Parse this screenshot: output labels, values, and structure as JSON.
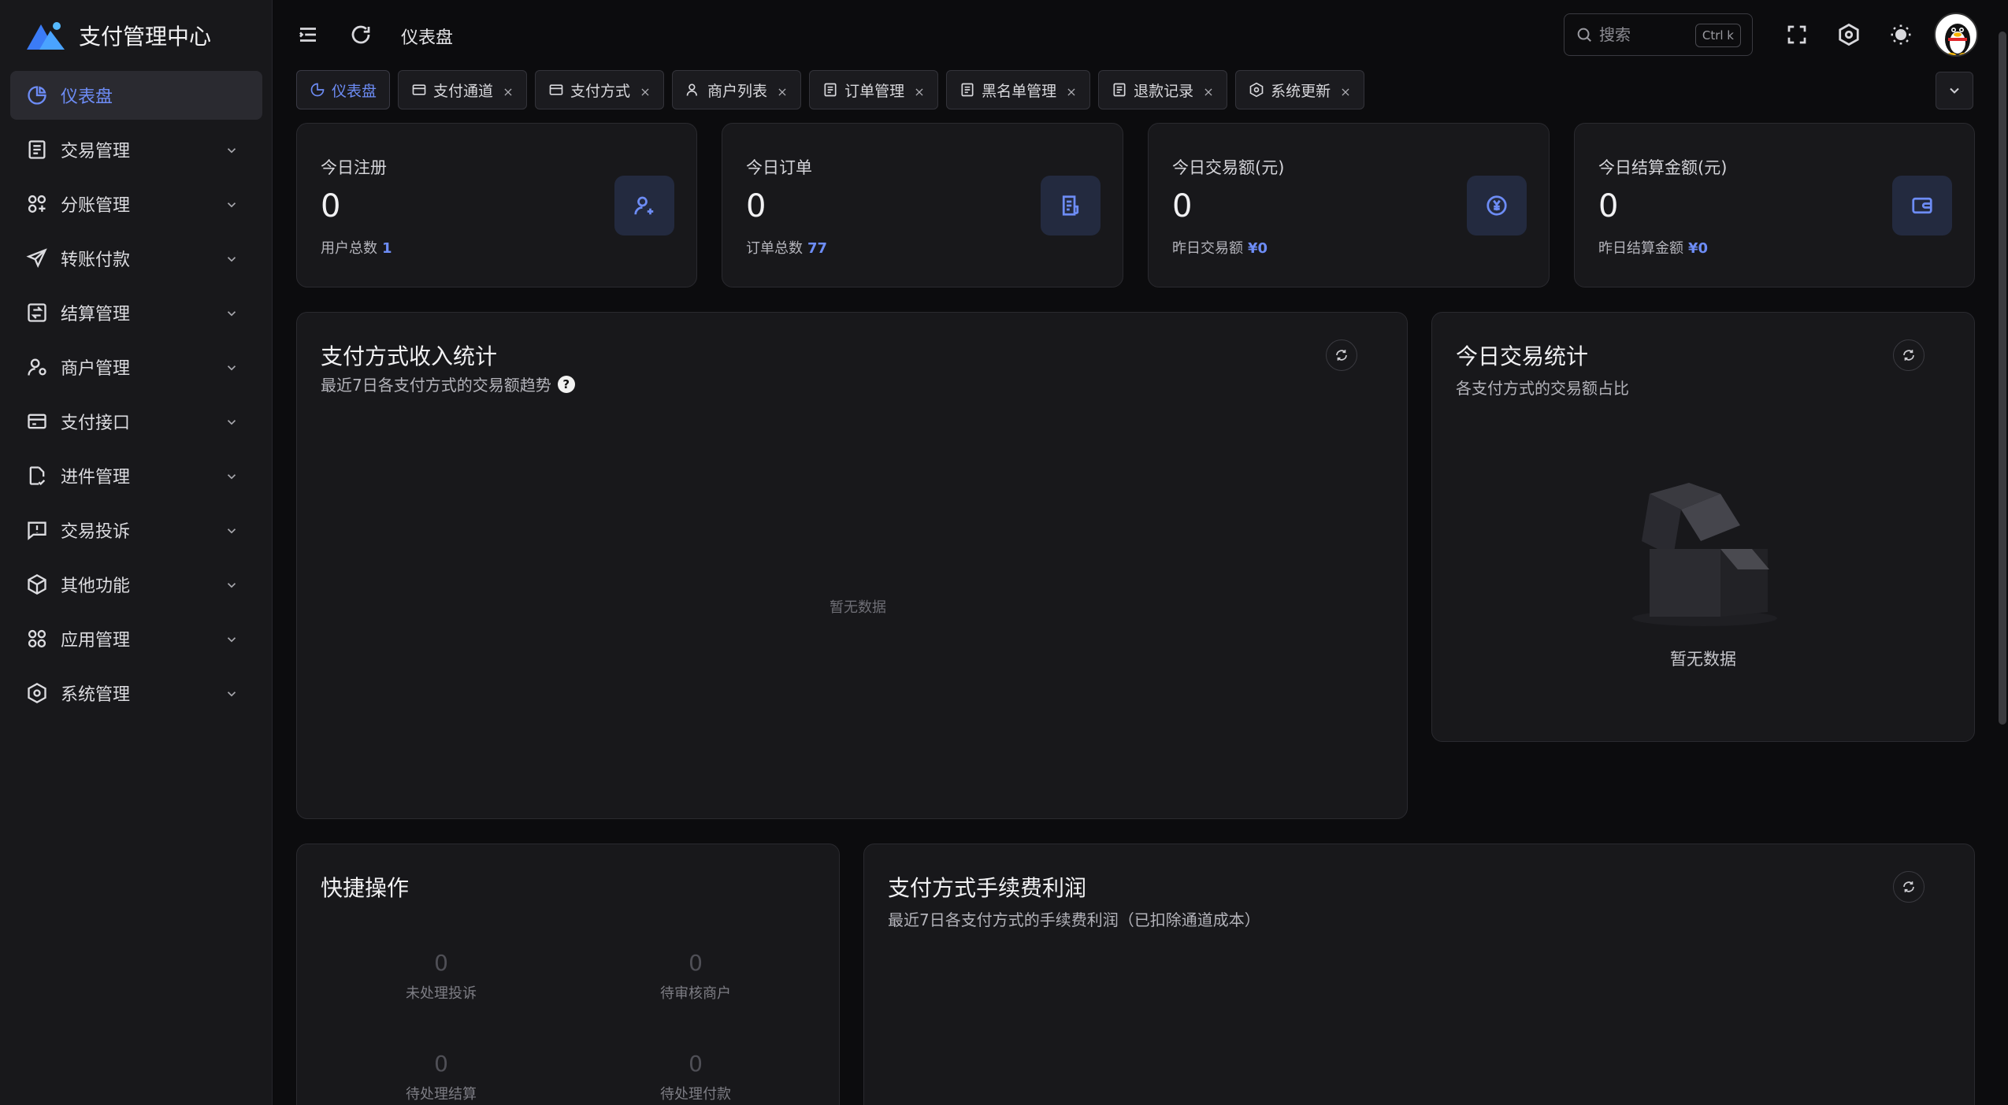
{
  "app": {
    "title": "支付管理中心"
  },
  "sidebar": {
    "items": [
      {
        "label": "仪表盘",
        "icon": "pie-chart-icon",
        "active": true
      },
      {
        "label": "交易管理",
        "icon": "receipt-icon"
      },
      {
        "label": "分账管理",
        "icon": "split-icon"
      },
      {
        "label": "转账付款",
        "icon": "send-icon"
      },
      {
        "label": "结算管理",
        "icon": "settlement-icon"
      },
      {
        "label": "商户管理",
        "icon": "merchant-user-icon"
      },
      {
        "label": "支付接口",
        "icon": "card-icon"
      },
      {
        "label": "进件管理",
        "icon": "document-check-icon"
      },
      {
        "label": "交易投诉",
        "icon": "alert-message-icon"
      },
      {
        "label": "其他功能",
        "icon": "cube-icon"
      },
      {
        "label": "应用管理",
        "icon": "apps-grid-icon"
      },
      {
        "label": "系统管理",
        "icon": "hexagon-gear-icon"
      }
    ]
  },
  "header": {
    "breadcrumb": "仪表盘",
    "search_placeholder": "搜索",
    "search_shortcut": "Ctrl k"
  },
  "tabs": [
    {
      "label": "仪表盘",
      "icon": "pie-chart-icon",
      "active": true,
      "closable": false
    },
    {
      "label": "支付通道",
      "icon": "card-icon",
      "closable": true
    },
    {
      "label": "支付方式",
      "icon": "card-icon",
      "closable": true
    },
    {
      "label": "商户列表",
      "icon": "user-icon",
      "closable": true
    },
    {
      "label": "订单管理",
      "icon": "receipt-icon",
      "closable": true
    },
    {
      "label": "黑名单管理",
      "icon": "receipt-icon",
      "closable": true
    },
    {
      "label": "退款记录",
      "icon": "receipt-icon",
      "closable": true
    },
    {
      "label": "系统更新",
      "icon": "hexagon-gear-icon",
      "closable": true
    }
  ],
  "stats": [
    {
      "title": "今日注册",
      "value": "0",
      "sub_label": "用户总数",
      "sub_value": "1",
      "icon": "user-add-icon"
    },
    {
      "title": "今日订单",
      "value": "0",
      "sub_label": "订单总数",
      "sub_value": "77",
      "icon": "order-doc-icon"
    },
    {
      "title": "今日交易额(元)",
      "value": "0",
      "sub_label": "昨日交易额",
      "sub_value": "¥0",
      "icon": "yen-coin-icon"
    },
    {
      "title": "今日结算金额(元)",
      "value": "0",
      "sub_label": "昨日结算金额",
      "sub_value": "¥0",
      "icon": "wallet-icon"
    }
  ],
  "income_panel": {
    "title": "支付方式收入统计",
    "subtitle": "最近7日各支付方式的交易额趋势",
    "empty": "暂无数据"
  },
  "today_panel": {
    "title": "今日交易统计",
    "subtitle": "各支付方式的交易额占比",
    "empty": "暂无数据"
  },
  "quick_panel": {
    "title": "快捷操作",
    "items": [
      {
        "value": "0",
        "label": "未处理投诉"
      },
      {
        "value": "0",
        "label": "待审核商户"
      },
      {
        "value": "0",
        "label": "待处理结算"
      },
      {
        "value": "0",
        "label": "待处理付款"
      }
    ]
  },
  "fee_panel": {
    "title": "支付方式手续费利润",
    "subtitle": "最近7日各支付方式的手续费利润（已扣除通道成本）"
  }
}
